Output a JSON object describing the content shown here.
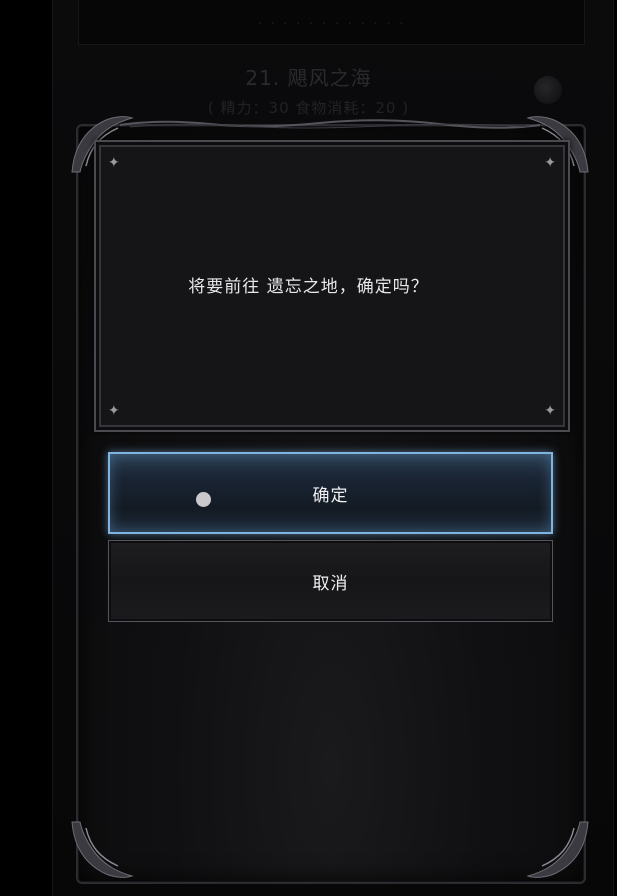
{
  "background": {
    "header_text": "· · · · ·  · · · · · · ·",
    "level_title": "21. 飓风之海",
    "level_info": "( 精力：30    食物消耗：20 )"
  },
  "dialog": {
    "message": "将要前往 遗忘之地，确定吗？",
    "confirm_label": "确定",
    "cancel_label": "取消"
  },
  "colors": {
    "confirm_border": "#7fb4de",
    "frame": "#2b2b30",
    "text": "#e8e8ea"
  }
}
